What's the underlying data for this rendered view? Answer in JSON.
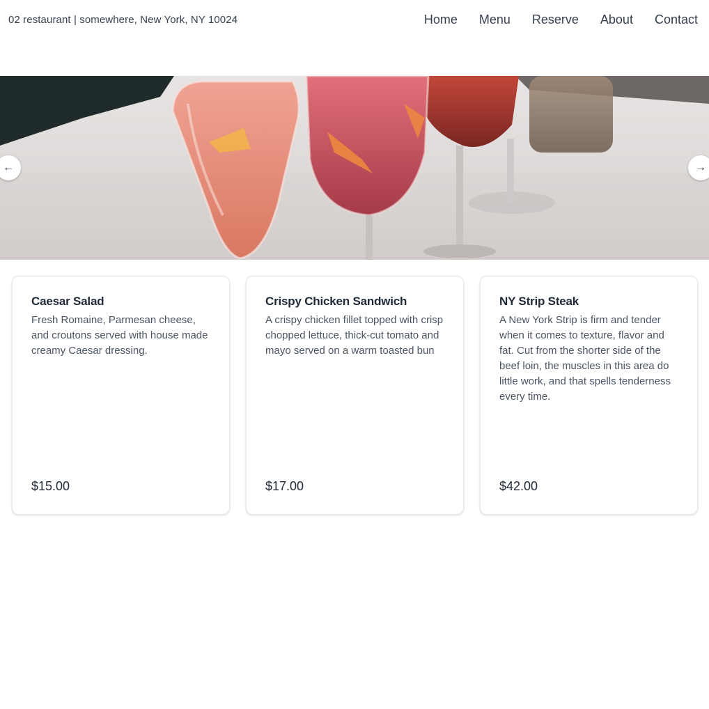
{
  "header": {
    "address": "02 restaurant | somewhere, New York, NY 10024",
    "nav": [
      "Home",
      "Menu",
      "Reserve",
      "About",
      "Contact"
    ]
  },
  "carousel": {
    "prev_icon": "arrow-left-icon",
    "next_icon": "arrow-right-icon",
    "prev_glyph": "←",
    "next_glyph": "→"
  },
  "menu_items": [
    {
      "name": "Caesar Salad",
      "description": "Fresh Romaine, Parmesan cheese, and croutons served with house made creamy Caesar dressing.",
      "price": "$15.00"
    },
    {
      "name": "Crispy Chicken Sandwich",
      "description": "A crispy chicken fillet topped with crisp chopped lettuce, thick-cut tomato and mayo served on a warm toasted bun",
      "price": "$17.00"
    },
    {
      "name": "NY Strip Steak",
      "description": "A New York Strip is firm and tender when it comes to texture, flavor and fat. Cut from the shorter side of the beef loin, the muscles in this area do little work, and that spells tenderness every time.",
      "price": "$42.00"
    }
  ]
}
